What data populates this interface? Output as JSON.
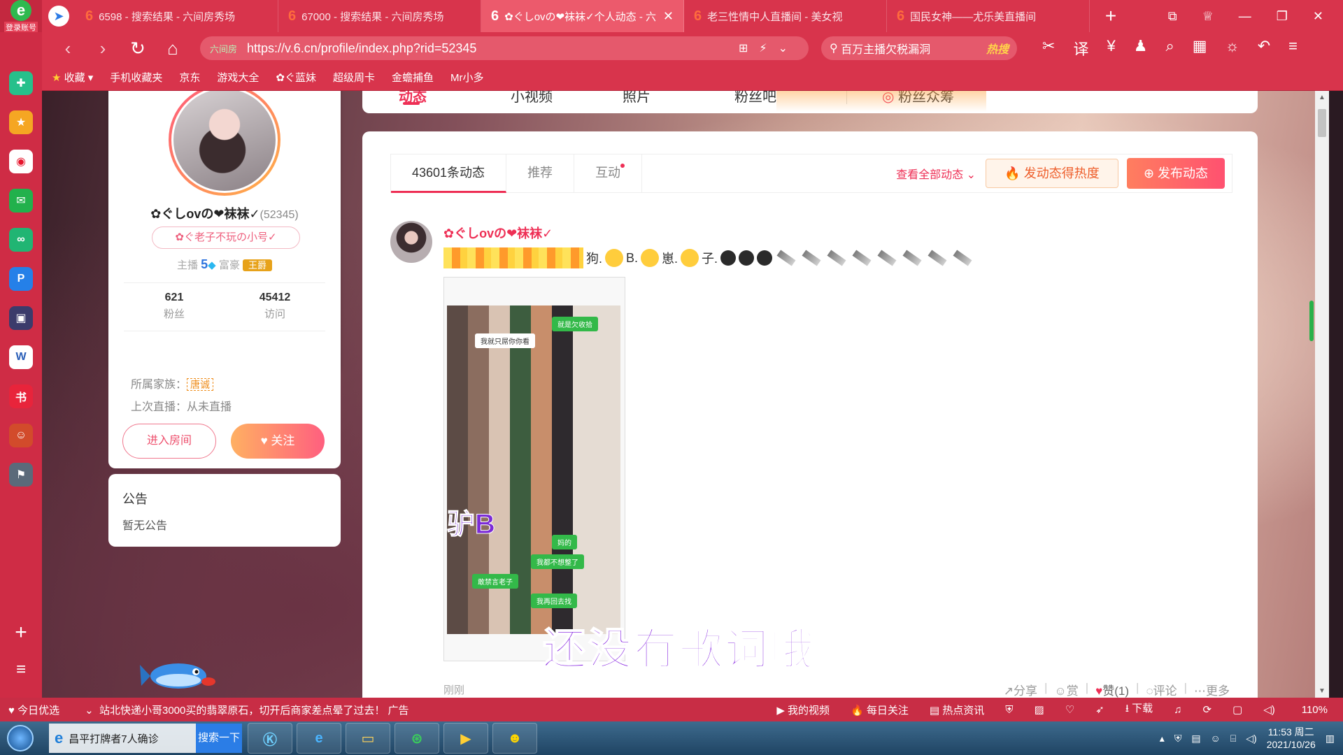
{
  "browser": {
    "logo_label": "登录账号",
    "tabs": [
      {
        "title": "6598 - 搜索结果 - 六间房秀场",
        "active": false
      },
      {
        "title": "67000 - 搜索结果 - 六间房秀场",
        "active": false
      },
      {
        "title": "✿ぐしovの❤袜袜✓个人动态 - 六",
        "active": true
      },
      {
        "title": "老三性情中人直播间 - 美女视",
        "active": false
      },
      {
        "title": "国民女神——尤乐美直播间",
        "active": false
      }
    ],
    "url": "https://v.6.cn/profile/index.php?rid=52345",
    "url_badge": "六间房",
    "search_text": "百万主播欠税漏洞",
    "search_hot": "热搜",
    "bookmarks": [
      "收藏",
      "手机收藏夹",
      "京东",
      "游戏大全",
      "✿ぐ蓝妹",
      "超级周卡",
      "金蟾捕鱼",
      "Mr小多"
    ]
  },
  "profile": {
    "nickname": "✿ぐしovの❤袜袜✓",
    "uid": "(52345)",
    "sub_tag": "✿ぐ老子不玩の小号✓",
    "anchor_label": "主播",
    "anchor_level": "5",
    "rich_label": "富豪",
    "rich_badge": "王爵",
    "fans_count": "621",
    "fans_label": "粉丝",
    "visits_count": "45412",
    "visits_label": "访问",
    "family_label": "所属家族：",
    "family_name": "唐诚",
    "last_live": "上次直播：从未直播",
    "enter_room": "进入房间",
    "follow": "关注"
  },
  "notice": {
    "title": "公告",
    "content": "暂无公告"
  },
  "top_nav": {
    "items": [
      "动态",
      "小视频",
      "照片",
      "粉丝吧",
      "粉丝众筹"
    ]
  },
  "feed": {
    "tabs": [
      "43601条动态",
      "推荐",
      "互动"
    ],
    "view_all": "查看全部动态",
    "heat_button": "发动态得热度",
    "publish_button": "发布动态",
    "post": {
      "author": "✿ぐしovの❤袜袜✓",
      "text_parts": [
        "狗.",
        "B.",
        "崽.",
        "子."
      ],
      "image_bubbles": [
        "就是欠收拾",
        "我就只屌你你看",
        "妈的",
        "我都不想整了",
        "敢禁言老子",
        "我再回去找"
      ],
      "image_big_text": "驴B",
      "lyrics": "还没有歌词哦",
      "time": "刚刚",
      "actions": {
        "share": "分享",
        "reward": "赏",
        "like": "赞(1)",
        "comment": "评论",
        "more": "更多"
      }
    }
  },
  "statusbar": {
    "today": "今日优选",
    "news": "站北快递小哥3000买的翡翠原石，切开后商家差点晕了过去！",
    "news_tag": "广告",
    "my_video": "我的视频",
    "daily": "每日关注",
    "hot_news": "热点资讯",
    "download": "下载",
    "zoom": "110%"
  },
  "taskbar": {
    "ie_text": "昌平打牌者7人确诊",
    "search_btn": "搜索一下",
    "time": "11:53 周二",
    "date": "2021/10/26"
  },
  "colors": {
    "brand_red": "#d8344c",
    "accent_pink": "#ee2f55",
    "lyrics_purple": "#8a2be2"
  }
}
